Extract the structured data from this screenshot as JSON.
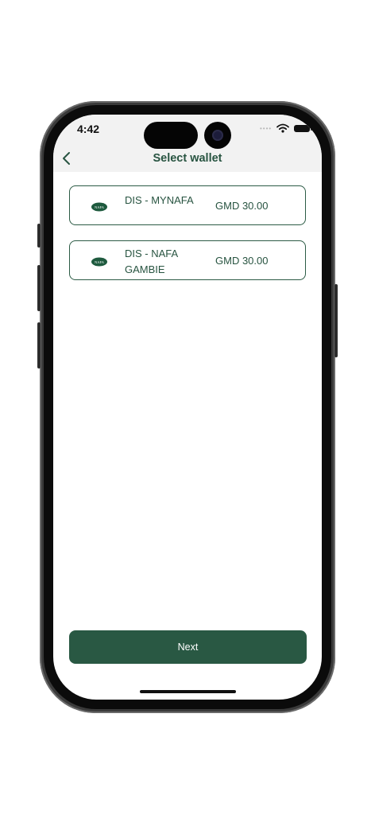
{
  "status_bar": {
    "time": "4:42",
    "signal": "••••"
  },
  "header": {
    "title": "Select wallet",
    "back_icon": "chevron-left-icon"
  },
  "wallets": [
    {
      "name": "DIS - MYNAFA",
      "amount": "GMD 30.00",
      "logo_text": "NAFA"
    },
    {
      "name": "DIS - NAFA GAMBIE",
      "amount": "GMD 30.00",
      "logo_text": "NAFA"
    }
  ],
  "footer": {
    "next_label": "Next"
  },
  "colors": {
    "primary": "#295843",
    "text": "#285441",
    "header_bg": "#f2f2f2"
  }
}
